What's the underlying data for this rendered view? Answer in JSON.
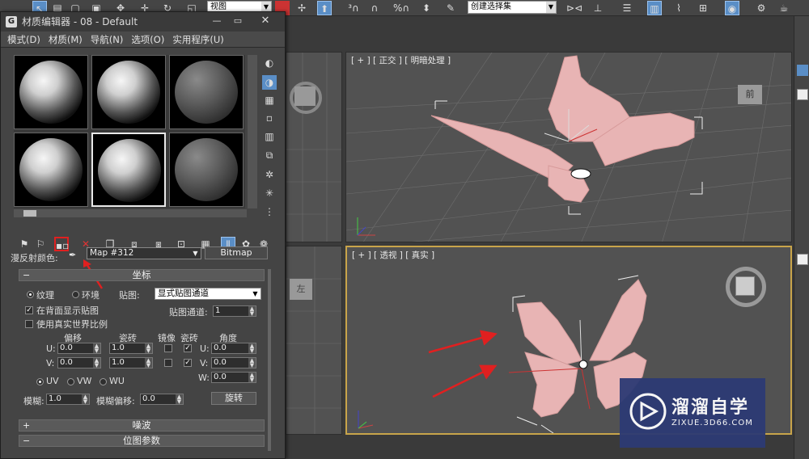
{
  "toolbar": {
    "view_dropdown": "视图",
    "selection_set_dropdown": "创建选择集"
  },
  "viewports": {
    "top": {
      "label": "[ + ] [ 正交 ] [ 明暗处理 ]",
      "cube_face": "前"
    },
    "persp": {
      "label": "[ + ] [ 透视 ] [ 真实 ]"
    },
    "left_top": {
      "cube_face": ""
    },
    "left_bottom": {
      "cube_face": "左"
    }
  },
  "material_editor": {
    "title": "材质编辑器 - 08 - Default",
    "menu": [
      "模式(D)",
      "材质(M)",
      "导航(N)",
      "选项(O)",
      "实用程序(U)"
    ],
    "diffuse_label": "漫反射颜色:",
    "map_name": "Map #312",
    "map_type": "Bitmap",
    "coordinates": {
      "header": "坐标",
      "texture_radio": "纹理",
      "environ_radio": "环境",
      "mapping_label": "贴图:",
      "mapping_value": "显式贴图通道",
      "show_back_label": "在背面显示贴图",
      "map_channel_label": "贴图通道:",
      "map_channel_value": "1",
      "real_world_label": "使用真实世界比例",
      "offset_hd": "偏移",
      "tiling_hd": "瓷砖",
      "mirror_hd": "镜像",
      "tile_hd": "瓷砖",
      "angle_hd": "角度",
      "u_label": "U:",
      "v_label": "V:",
      "w_label": "W:",
      "u_offset": "0.0",
      "v_offset": "0.0",
      "u_tiling": "1.0",
      "v_tiling": "1.0",
      "u_angle": "0.0",
      "v_angle": "0.0",
      "w_angle": "0.0",
      "uv": "UV",
      "vw": "VW",
      "wu": "WU",
      "blur_label": "模糊:",
      "blur_value": "1.0",
      "blur_offset_label": "模糊偏移:",
      "blur_offset_value": "0.0",
      "rotate_button": "旋转"
    },
    "noise_header": "噪波",
    "bitmap_params_header": "位图参数"
  },
  "watermark": {
    "title": "溜溜自学",
    "url": "ZIXUE.3D66.COM"
  },
  "colors": {
    "accent_active_viewport": "#c8a44a",
    "butterfly_pink": "#e8b4b4",
    "highlight_red": "#e02020",
    "watermark_blue": "#2d3a74"
  }
}
